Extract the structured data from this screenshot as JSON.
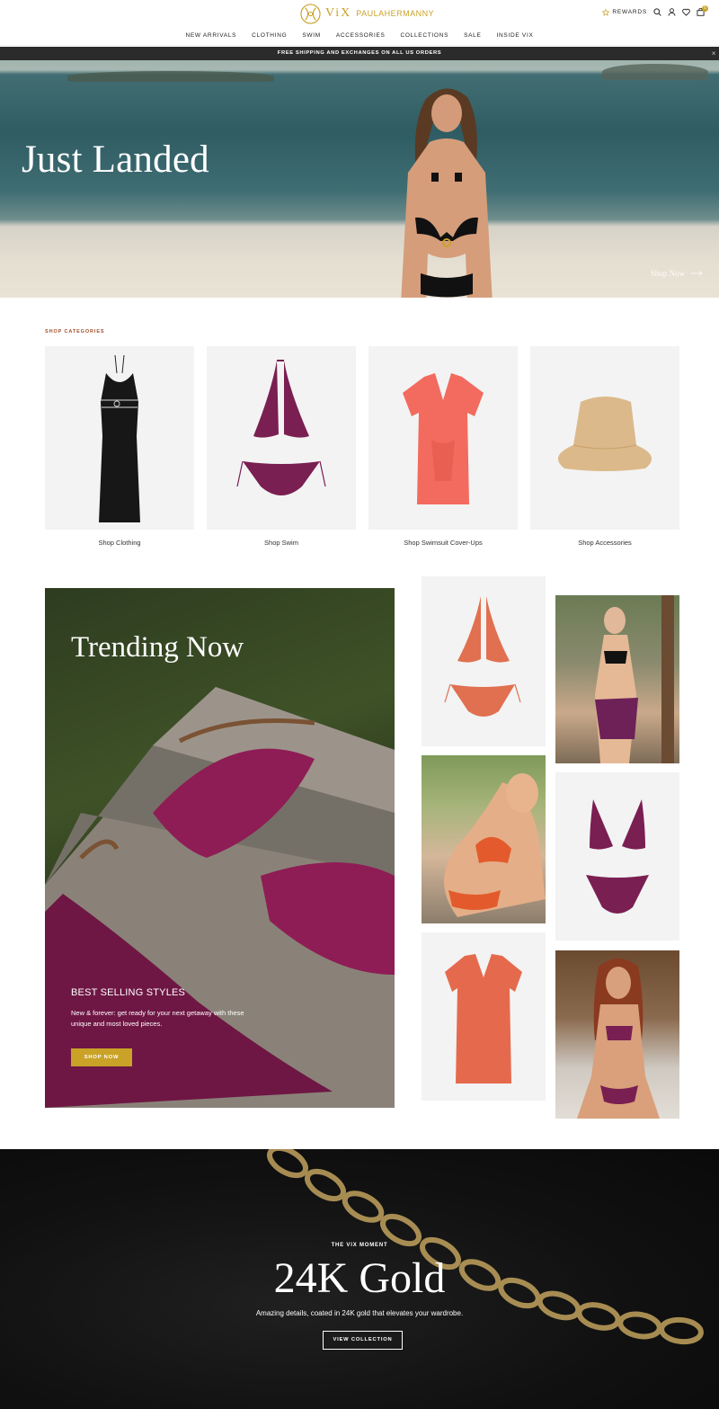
{
  "brand": {
    "logo_text": "ViX",
    "logo_sub": "PAULAHERMANNY"
  },
  "header": {
    "rewards_label": "REWARDS",
    "icons": [
      "star-icon",
      "search-icon",
      "account-icon",
      "wishlist-heart-icon",
      "cart-icon"
    ],
    "cart_count": "0",
    "nav": [
      "NEW ARRIVALS",
      "CLOTHING",
      "SWIM",
      "ACCESSORIES",
      "COLLECTIONS",
      "SALE",
      "INSIDE VIX"
    ]
  },
  "promo": {
    "text": "FREE SHIPPING AND EXCHANGES ON ALL US ORDERS",
    "close": "×"
  },
  "hero": {
    "title": "Just Landed",
    "cta": "Shop Now"
  },
  "categories": {
    "label": "SHOP CATEGORIES",
    "items": [
      {
        "label": "Shop Clothing"
      },
      {
        "label": "Shop Swim"
      },
      {
        "label": "Shop Swimsuit Cover-Ups"
      },
      {
        "label": "Shop Accessories"
      }
    ]
  },
  "trending": {
    "title": "Trending Now",
    "subtitle": "BEST SELLING STYLES",
    "body": "New & forever: get ready for your next getaway with these unique and most loved pieces.",
    "cta": "SHOP NOW"
  },
  "gold": {
    "eyebrow": "THE VIX MOMENT",
    "title": "24K Gold",
    "body": "Amazing details, coated in 24K gold that elevates your wardrobe.",
    "cta": "VIEW COLLECTION"
  },
  "colors": {
    "accent": "#c9a227",
    "promo_bg": "#2b2b2b",
    "category_label": "#a0522d"
  }
}
